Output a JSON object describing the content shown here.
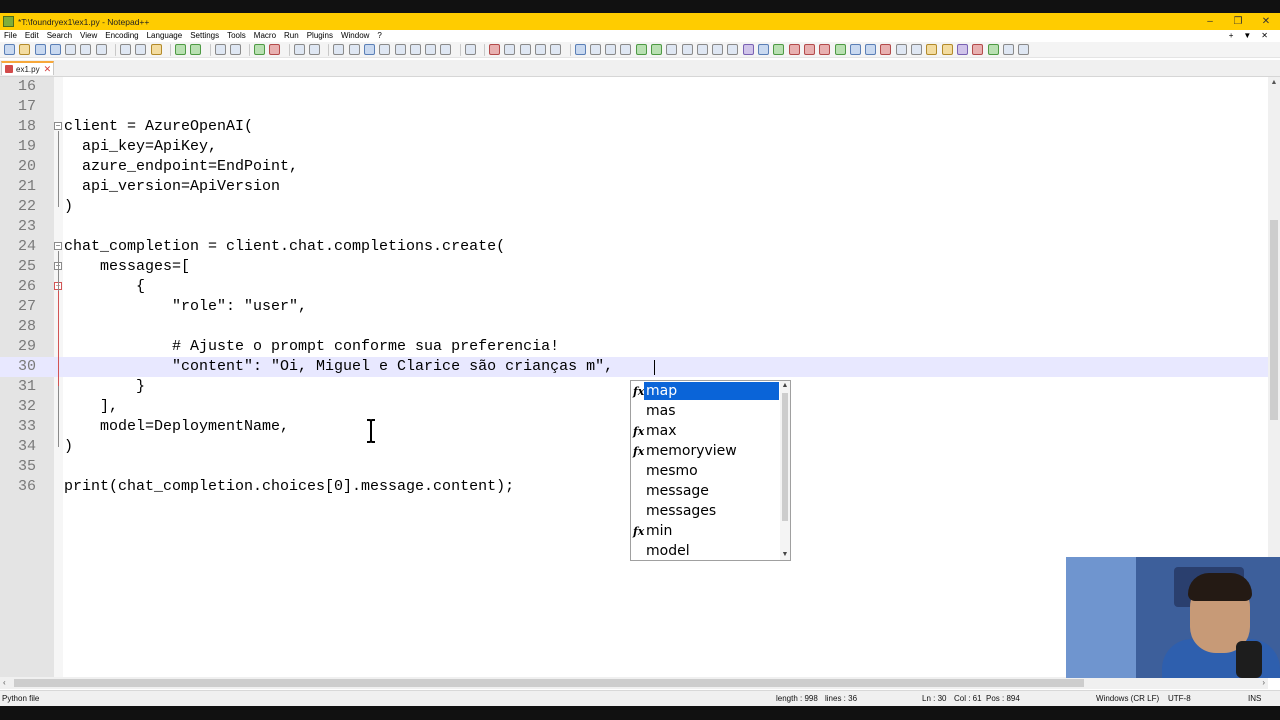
{
  "window": {
    "title": "*T:\\foundryex1\\ex1.py - Notepad++",
    "controls": [
      "–",
      "❐",
      "✕"
    ]
  },
  "menu": {
    "items": [
      "File",
      "Edit",
      "Search",
      "View",
      "Encoding",
      "Language",
      "Settings",
      "Tools",
      "Macro",
      "Run",
      "Plugins",
      "Window",
      "?"
    ],
    "right": [
      "+",
      "▼",
      "✕"
    ]
  },
  "tab": {
    "label": "ex1.py",
    "close": "✕"
  },
  "editor": {
    "lines": [
      {
        "n": "16",
        "text": ""
      },
      {
        "n": "17",
        "text": ""
      },
      {
        "n": "18",
        "text": "client = AzureOpenAI("
      },
      {
        "n": "19",
        "text": "  api_key=ApiKey,"
      },
      {
        "n": "20",
        "text": "  azure_endpoint=EndPoint,"
      },
      {
        "n": "21",
        "text": "  api_version=ApiVersion"
      },
      {
        "n": "22",
        "text": ")"
      },
      {
        "n": "23",
        "text": ""
      },
      {
        "n": "24",
        "text": "chat_completion = client.chat.completions.create("
      },
      {
        "n": "25",
        "text": "    messages=["
      },
      {
        "n": "26",
        "text": "        {"
      },
      {
        "n": "27",
        "text": "            \"role\": \"user\","
      },
      {
        "n": "28",
        "text": ""
      },
      {
        "n": "29",
        "text": "            # Ajuste o prompt conforme sua preferencia!"
      },
      {
        "n": "30",
        "text": "            \"content\": \"Oi, Miguel e Clarice são crianças m\","
      },
      {
        "n": "31",
        "text": "        }"
      },
      {
        "n": "32",
        "text": "    ],"
      },
      {
        "n": "33",
        "text": "    model=DeploymentName,"
      },
      {
        "n": "34",
        "text": ")"
      },
      {
        "n": "35",
        "text": ""
      },
      {
        "n": "36",
        "text": "print(chat_completion.choices[0].message.content);"
      }
    ],
    "current_line": "30"
  },
  "autocomplete": {
    "items": [
      {
        "label": "map",
        "fx": true,
        "selected": true
      },
      {
        "label": "mas",
        "fx": false
      },
      {
        "label": "max",
        "fx": true
      },
      {
        "label": "memoryview",
        "fx": true
      },
      {
        "label": "mesmo",
        "fx": false
      },
      {
        "label": "message",
        "fx": false
      },
      {
        "label": "messages",
        "fx": false
      },
      {
        "label": "min",
        "fx": true
      },
      {
        "label": "model",
        "fx": false
      }
    ],
    "fx_glyph": "fx"
  },
  "status": {
    "file_type": "Python file",
    "length": "length : 998",
    "lines": "lines : 36",
    "ln": "Ln : 30",
    "col": "Col : 61",
    "pos": "Pos : 894",
    "eol": "Windows (CR LF)",
    "encoding": "UTF-8",
    "mode": "INS"
  },
  "colors": {
    "titlebar": "#ffcc00",
    "current_line": "#e8e8ff",
    "selection": "#0a64d8",
    "comment": "#008000",
    "string": "#808080",
    "operator": "#000080"
  }
}
